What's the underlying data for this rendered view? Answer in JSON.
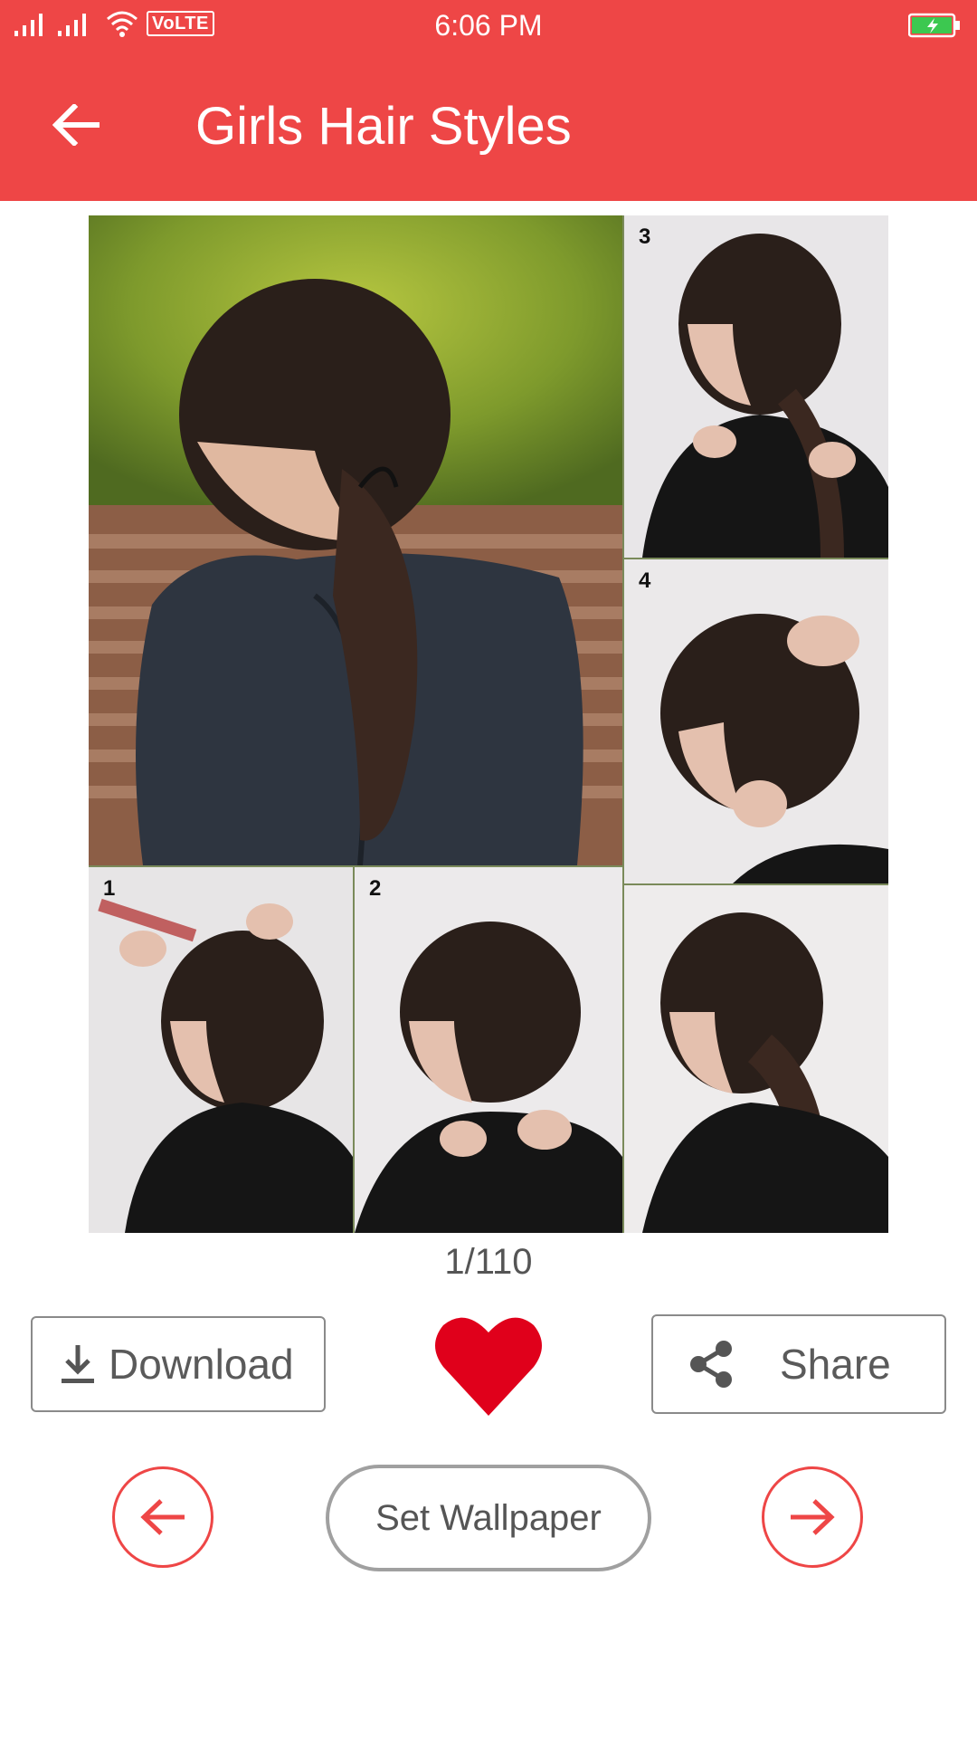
{
  "status_bar": {
    "time": "6:06 PM",
    "network_label": "VoLTE",
    "icons": [
      "signal-icon",
      "signal-icon",
      "wifi-icon",
      "battery-charging-icon"
    ]
  },
  "app_bar": {
    "title": "Girls Hair Styles",
    "back_icon": "arrow-left-icon",
    "color": "#ee4646"
  },
  "image_viewer": {
    "step_labels": [
      "3",
      "4",
      "1",
      "2"
    ],
    "counter": "1/110"
  },
  "actions": {
    "download_label": "Download",
    "download_icon": "download-icon",
    "favorite_icon": "heart-icon",
    "favorite_color": "#e0001b",
    "share_label": "Share",
    "share_icon": "share-icon"
  },
  "navigation": {
    "prev_icon": "arrow-left-icon",
    "next_icon": "arrow-right-icon",
    "set_wallpaper_label": "Set Wallpaper",
    "accent_color": "#ee4646"
  }
}
